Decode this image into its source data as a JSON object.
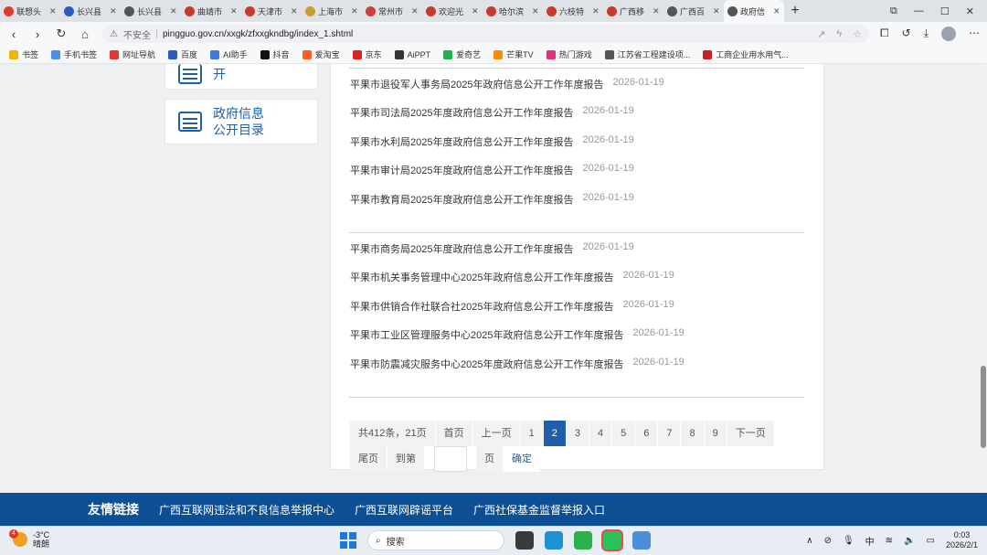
{
  "browser": {
    "tabs": [
      {
        "title": "联想头",
        "color": "#e03a2f"
      },
      {
        "title": "长兴县",
        "color": "#2b59c3"
      },
      {
        "title": "长兴县",
        "color": "#555555"
      },
      {
        "title": "曲靖市",
        "color": "#c83a2a"
      },
      {
        "title": "天津市",
        "color": "#c83a2a"
      },
      {
        "title": "上海市",
        "color": "#c8a032"
      },
      {
        "title": "常州市",
        "color": "#d23c3c"
      },
      {
        "title": "欢迎光",
        "color": "#c83a2a"
      },
      {
        "title": "哈尔滨",
        "color": "#c83a2a"
      },
      {
        "title": "六枝特",
        "color": "#c83a2a"
      },
      {
        "title": "广西移",
        "color": "#c83a2a"
      },
      {
        "title": "广西百",
        "color": "#555555"
      },
      {
        "title": "政府信",
        "color": "#555555",
        "active": true
      }
    ],
    "new_tab": "+",
    "insecure_label": "不安全",
    "url": "pingguo.gov.cn/xxgk/zfxxgkndbg/index_1.shtml"
  },
  "bookmarks": [
    {
      "label": "书签",
      "color": "#f0b400"
    },
    {
      "label": "手机书签",
      "color": "#4a8cf0"
    },
    {
      "label": "网址导航",
      "color": "#e03a2f"
    },
    {
      "label": "百度",
      "color": "#2b59c3"
    },
    {
      "label": "AI助手",
      "color": "#3c78e0"
    },
    {
      "label": "抖音",
      "color": "#111111"
    },
    {
      "label": "爱淘宝",
      "color": "#ff5a1f"
    },
    {
      "label": "京东",
      "color": "#e02020"
    },
    {
      "label": "AiPPT",
      "color": "#333333"
    },
    {
      "label": "爱奇艺",
      "color": "#22b24c"
    },
    {
      "label": "芒果TV",
      "color": "#ff8a00"
    },
    {
      "label": "热门游戏",
      "color": "#e0307a"
    },
    {
      "label": "江苏省工程建设项...",
      "color": "#555555"
    },
    {
      "label": "工商企业用水用气...",
      "color": "#c82020"
    }
  ],
  "sidebar": {
    "card1_label": "开",
    "card2_line1": "政府信息",
    "card2_line2": "公开目录"
  },
  "list": [
    {
      "title": "平果市退役军人事务局2025年政府信息公开工作年度报告",
      "date": "2026-01-19"
    },
    {
      "title": "平果市司法局2025年度政府信息公开工作年度报告",
      "date": "2026-01-19"
    },
    {
      "title": "平果市水利局2025年度政府信息公开工作年度报告",
      "date": "2026-01-19"
    },
    {
      "title": "平果市审计局2025年度政府信息公开工作年度报告",
      "date": "2026-01-19"
    },
    {
      "title": "平果市教育局2025年度政府信息公开工作年度报告",
      "date": "2026-01-19"
    },
    {
      "title": "平果市商务局2025年度政府信息公开工作年度报告",
      "date": "2026-01-19"
    },
    {
      "title": "平果市机关事务管理中心2025年政府信息公开工作年度报告",
      "date": "2026-01-19"
    },
    {
      "title": "平果市供销合作社联合社2025年政府信息公开工作年度报告",
      "date": "2026-01-19"
    },
    {
      "title": "平果市工业区管理服务中心2025年政府信息公开工作年度报告",
      "date": "2026-01-19"
    },
    {
      "title": "平果市防震减灾服务中心2025年度政府信息公开工作年度报告",
      "date": "2026-01-19"
    }
  ],
  "pager": {
    "summary": "共412条，21页",
    "first": "首页",
    "prev": "上一页",
    "pages": [
      "1",
      "2",
      "3",
      "4",
      "5",
      "6",
      "7",
      "8",
      "9"
    ],
    "current": "2",
    "next": "下一页",
    "last": "尾页",
    "goto": "到第",
    "page_unit": "页",
    "confirm": "确定"
  },
  "footer": {
    "heading": "友情链接",
    "links": [
      "广西互联网违法和不良信息举报中心",
      "广西互联网辟谣平台",
      "广西社保基金监督举报入口"
    ]
  },
  "taskbar": {
    "badge": "4",
    "temp": "-3°C",
    "weather": "晴朗",
    "search": "搜索",
    "ime": "中",
    "time": "0:03",
    "date": "2026/2/1"
  }
}
